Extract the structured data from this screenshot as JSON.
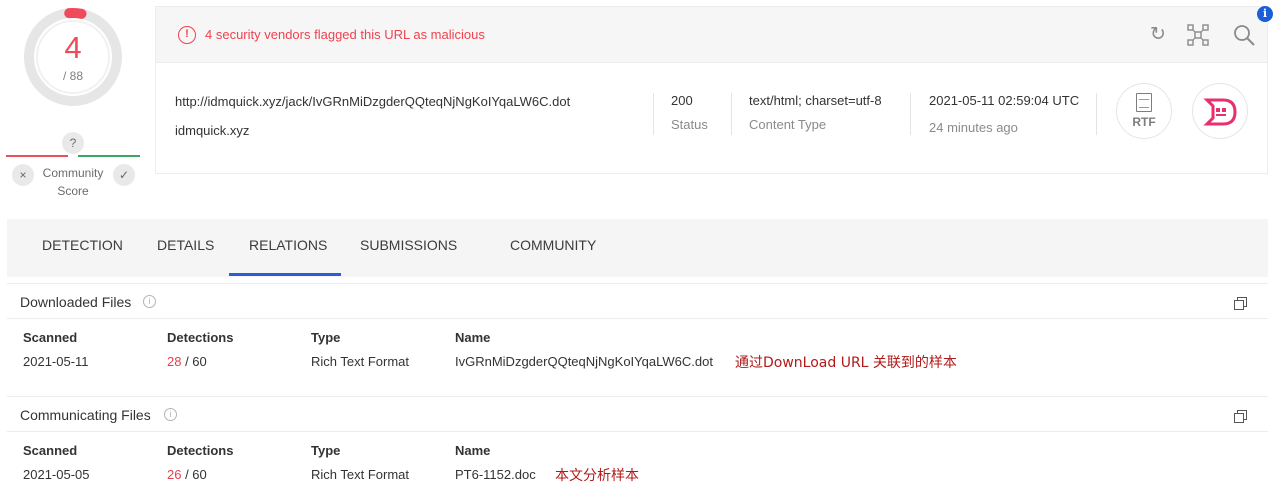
{
  "score": {
    "detections": "4",
    "total": "/ 88",
    "fraction": 0.045,
    "color": "#f04b5a",
    "community": {
      "question_mark": "?",
      "label_line1": "Community",
      "label_line2": "Score",
      "vote_bad_icon": "×",
      "vote_good_icon": "✓"
    }
  },
  "alert": {
    "icon": "!",
    "text": "4 security vendors flagged this URL as malicious",
    "color": "#f0424f"
  },
  "header_actions": [
    {
      "name": "reanalyze-icon",
      "glyph": "↻"
    },
    {
      "name": "graph-icon",
      "glyph": "⌗"
    },
    {
      "name": "search-icon",
      "glyph": "⌕"
    }
  ],
  "info_badge": "i",
  "url": {
    "full": "http://idmquick.xyz/jack/IvGRnMiDzgderQQteqNjNgKoIYqaLW6C.dot",
    "domain": "idmquick.xyz"
  },
  "meta": {
    "status_value": "200",
    "status_label": "Status",
    "content_type_value": "text/html; charset=utf-8",
    "content_type_label": "Content Type",
    "date_value": "2021-05-11 02:59:04 UTC",
    "date_relative": "24 minutes ago"
  },
  "file_type_badge": "RTF",
  "tabs": [
    {
      "label": "DETECTION",
      "active": false
    },
    {
      "label": "DETAILS",
      "active": false
    },
    {
      "label": "RELATIONS",
      "active": true
    },
    {
      "label": "SUBMISSIONS",
      "active": false
    },
    {
      "label": "COMMUNITY",
      "active": false
    }
  ],
  "accent_color": "#2c5cd6",
  "downloaded": {
    "title": "Downloaded Files",
    "columns": [
      "Scanned",
      "Detections",
      "Type",
      "Name"
    ],
    "row": {
      "scanned": "2021-05-11",
      "detections_hit": "28",
      "detections_total": " / 60",
      "type": "Rich Text Format",
      "name": "IvGRnMiDzgderQQteqNjNgKoIYqaLW6C.dot"
    },
    "annotation": "通过DownLoad URL 关联到的样本"
  },
  "communicating": {
    "title": "Communicating Files",
    "columns": [
      "Scanned",
      "Detections",
      "Type",
      "Name"
    ],
    "row": {
      "scanned": "2021-05-05",
      "detections_hit": "26",
      "detections_total": " / 60",
      "type": "Rich Text Format",
      "name": "PT6-1152.doc"
    },
    "annotation": "本文分析样本"
  }
}
